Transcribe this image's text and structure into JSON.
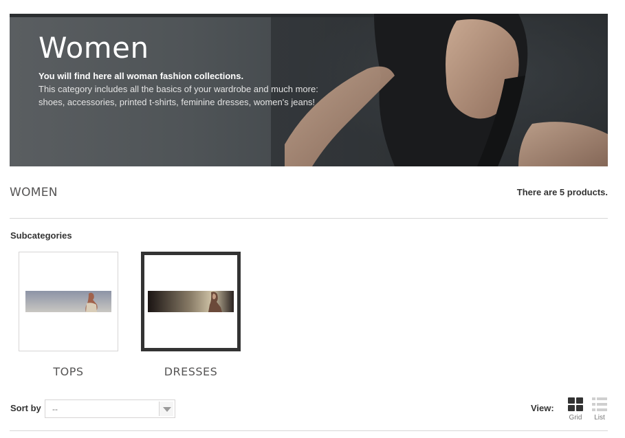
{
  "banner": {
    "title": "Women",
    "lead": "You will find here all woman fashion collections.",
    "description": "This category includes all the basics of your wardrobe and much more: shoes, accessories, printed t-shirts, feminine dresses, women's jeans!"
  },
  "category": {
    "name": "WOMEN",
    "product_count": "There are 5 products."
  },
  "subcategories": {
    "title": "Subcategories",
    "items": [
      {
        "label": "TOPS",
        "active": false
      },
      {
        "label": "DRESSES",
        "active": true
      }
    ]
  },
  "sort": {
    "label": "Sort by",
    "selected": "--"
  },
  "view": {
    "label": "View:",
    "options": [
      {
        "label": "Grid",
        "icon": "grid-icon",
        "selected": true
      },
      {
        "label": "List",
        "icon": "list-icon",
        "selected": false
      }
    ]
  },
  "colors": {
    "text": "#333333",
    "heading": "#555454",
    "border": "#d6d4d4",
    "active_border": "#333333"
  }
}
